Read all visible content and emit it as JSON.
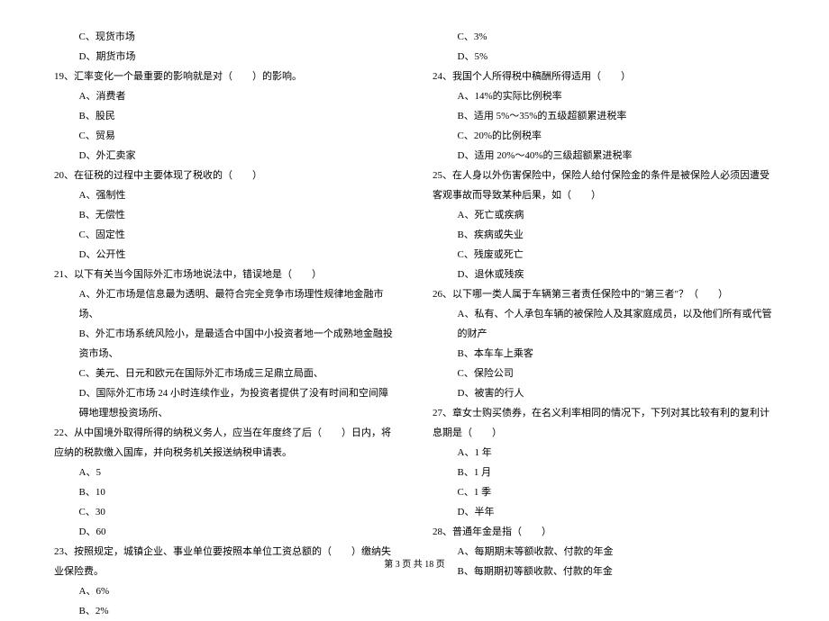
{
  "left": {
    "opt_c_18": "C、现货市场",
    "opt_d_18": "D、期货市场",
    "q19": "19、汇率变化一个最重要的影响就是对（　　）的影响。",
    "q19_a": "A、消费者",
    "q19_b": "B、股民",
    "q19_c": "C、贸易",
    "q19_d": "D、外汇卖家",
    "q20": "20、在征税的过程中主要体现了税收的（　　）",
    "q20_a": "A、强制性",
    "q20_b": "B、无偿性",
    "q20_c": "C、固定性",
    "q20_d": "D、公开性",
    "q21": "21、以下有关当今国际外汇市场地说法中，错误地是（　　）",
    "q21_a": "A、外汇市场是信息最为透明、最符合完全竞争市场理性规律地金融市场、",
    "q21_b": "B、外汇市场系统风险小，是最适合中国中小投资者地一个成熟地金融投资市场、",
    "q21_c": "C、美元、日元和欧元在国际外汇市场成三足鼎立局面、",
    "q21_d": "D、国际外汇市场 24 小时连续作业，为投资者提供了没有时间和空间障碍地理想投资场所、",
    "q22": "22、从中国境外取得所得的纳税义务人，应当在年度终了后（　　）日内，将应纳的税款缴入国库，并向税务机关报送纳税申请表。",
    "q22_a": "A、5",
    "q22_b": "B、10",
    "q22_c": "C、30",
    "q22_d": "D、60",
    "q23": "23、按照规定，城镇企业、事业单位要按照本单位工资总额的（　　）缴纳失业保险费。",
    "q23_a": "A、6%",
    "q23_b": "B、2%"
  },
  "right": {
    "q23_c": "C、3%",
    "q23_d": "D、5%",
    "q24": "24、我国个人所得税中稿酬所得适用（　　）",
    "q24_a": "A、14%的实际比例税率",
    "q24_b": "B、适用 5%～35%的五级超额累进税率",
    "q24_c": "C、20%的比例税率",
    "q24_d": "D、适用 20%～40%的三级超额累进税率",
    "q25": "25、在人身以外伤害保险中，保险人给付保险金的条件是被保险人必须因遭受客观事故而导致某种后果，如（　　）",
    "q25_a": "A、死亡或疾病",
    "q25_b": "B、疾病或失业",
    "q25_c": "C、残废或死亡",
    "q25_d": "D、退休或残疾",
    "q26": "26、以下哪一类人属于车辆第三者责任保险中的\"第三者\"？（　　）",
    "q26_a": "A、私有、个人承包车辆的被保险人及其家庭成员，以及他们所有或代管的财产",
    "q26_b": "B、本车车上乘客",
    "q26_c": "C、保险公司",
    "q26_d": "D、被害的行人",
    "q27": "27、章女士购买债券，在名义利率相同的情况下，下列对其比较有利的复利计息期是（　　）",
    "q27_a": "A、1 年",
    "q27_b": "B、1 月",
    "q27_c": "C、1 季",
    "q27_d": "D、半年",
    "q28": "28、普通年金是指（　　）",
    "q28_a": "A、每期期末等额收款、付款的年金",
    "q28_b": "B、每期期初等额收款、付款的年金"
  },
  "footer": "第 3 页 共 18 页"
}
